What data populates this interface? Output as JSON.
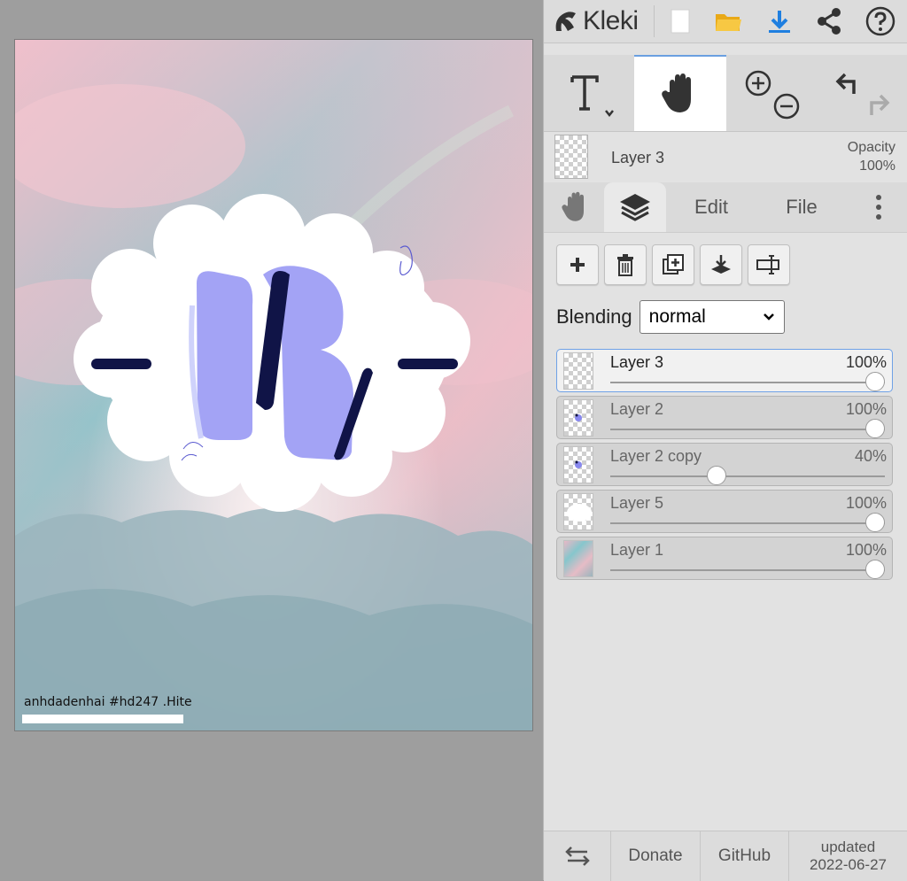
{
  "canvas": {
    "watermark": "anhdadenhai #hd247 .Hite"
  },
  "header": {
    "logo_text": "Kleki"
  },
  "current_layer": {
    "name": "Layer 3",
    "opacity_label": "Opacity",
    "opacity_value": "100%"
  },
  "tabs": {
    "edit": "Edit",
    "file": "File"
  },
  "blending": {
    "label": "Blending",
    "value": "normal"
  },
  "layers": [
    {
      "name": "Layer 3",
      "opacity": "100%",
      "level": 100,
      "selected": true,
      "thumb": "empty"
    },
    {
      "name": "Layer 2",
      "opacity": "100%",
      "level": 100,
      "selected": false,
      "thumb": "dots"
    },
    {
      "name": "Layer 2 copy",
      "opacity": "40%",
      "level": 40,
      "selected": false,
      "thumb": "dots"
    },
    {
      "name": "Layer 5",
      "opacity": "100%",
      "level": 100,
      "selected": false,
      "thumb": "cloud"
    },
    {
      "name": "Layer 1",
      "opacity": "100%",
      "level": 100,
      "selected": false,
      "thumb": "sky"
    }
  ],
  "footer": {
    "donate": "Donate",
    "github": "GitHub",
    "updated_label": "updated",
    "updated_date": "2022-06-27"
  },
  "colors": {
    "accent": "#6a9fe0",
    "download_blue": "#1f7fe0",
    "folder_yellow": "#f0b51b",
    "letter_fill": "#a3a3f5",
    "letter_shadow": "#101447"
  }
}
